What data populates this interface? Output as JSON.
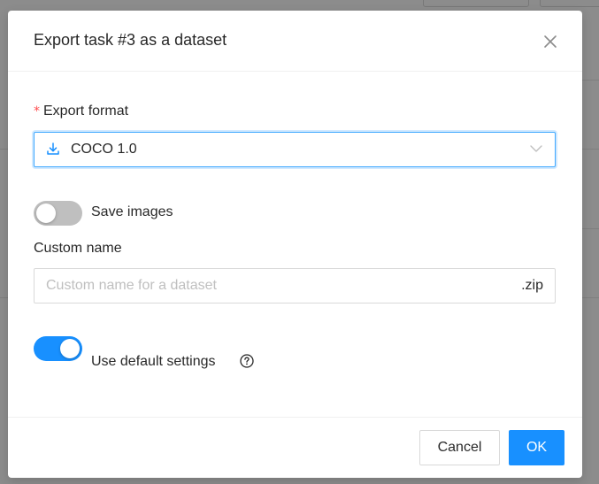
{
  "dialog": {
    "title": "Export task #3 as a dataset",
    "close_icon": "close-icon"
  },
  "form": {
    "export_format": {
      "label": "Export format",
      "required": true,
      "selected_value": "COCO 1.0",
      "icon": "download-icon"
    },
    "save_images": {
      "label": "Save images",
      "enabled": false
    },
    "custom_name": {
      "label": "Custom name",
      "value": "",
      "placeholder": "Custom name for a dataset",
      "suffix": ".zip"
    },
    "use_default_settings": {
      "label": "Use default settings",
      "enabled": true,
      "help_icon": "question-circle-icon"
    }
  },
  "footer": {
    "cancel_label": "Cancel",
    "ok_label": "OK"
  },
  "colors": {
    "primary": "#1890ff",
    "required": "#ff4d4f",
    "switch_off": "#bfbfbf"
  }
}
